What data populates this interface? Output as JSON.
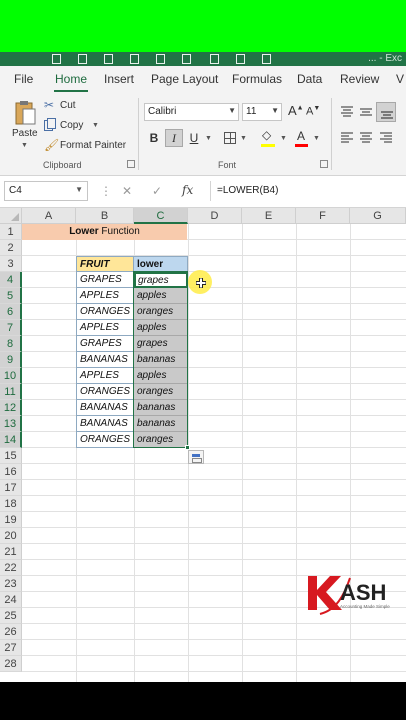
{
  "window": {
    "title_partial": "... -  Exc"
  },
  "ribbon_tabs": [
    "File",
    "Home",
    "Insert",
    "Page Layout",
    "Formulas",
    "Data",
    "Review",
    "V"
  ],
  "active_tab": "Home",
  "clipboard": {
    "paste_label": "Paste",
    "cut_label": "Cut",
    "copy_label": "Copy",
    "format_painter_label": "Format Painter",
    "group_label": "Clipboard"
  },
  "font": {
    "font_name": "Calibri",
    "font_size": "11",
    "bold_label": "B",
    "italic_label": "I",
    "underline_label": "U",
    "group_label": "Font",
    "fill_color": "#ffff00",
    "font_color": "#ff0000"
  },
  "formula_bar": {
    "name_box": "C4",
    "cancel_glyph": "✕",
    "enter_glyph": "✓",
    "fx_label": "fx",
    "formula": "=LOWER(B4)"
  },
  "sheet": {
    "columns": [
      "A",
      "B",
      "C",
      "D",
      "E",
      "F",
      "G"
    ],
    "selected_column": "C",
    "rows": [
      "1",
      "2",
      "3",
      "4",
      "5",
      "6",
      "7",
      "8",
      "9",
      "10",
      "11",
      "12",
      "13",
      "14",
      "15",
      "16",
      "17",
      "18",
      "19",
      "20",
      "21",
      "22",
      "23",
      "24",
      "25",
      "26",
      "27",
      "28"
    ],
    "selected_rows": [
      "4",
      "5",
      "6",
      "7",
      "8",
      "9",
      "10",
      "11",
      "12",
      "13",
      "14"
    ],
    "title_bold": "Lower",
    "title_rest": " Function",
    "header_fruit": "FRUIT",
    "header_lower": "lower",
    "table": [
      {
        "fruit": "GRAPES",
        "lower": "grapes"
      },
      {
        "fruit": "APPLES",
        "lower": "apples"
      },
      {
        "fruit": "ORANGES",
        "lower": "oranges"
      },
      {
        "fruit": "APPLES",
        "lower": "apples"
      },
      {
        "fruit": "GRAPES",
        "lower": "grapes"
      },
      {
        "fruit": "BANANAS",
        "lower": "bananas"
      },
      {
        "fruit": "APPLES",
        "lower": "apples"
      },
      {
        "fruit": "ORANGES",
        "lower": "oranges"
      },
      {
        "fruit": "BANANAS",
        "lower": "bananas"
      },
      {
        "fruit": "BANANAS",
        "lower": "bananas"
      },
      {
        "fruit": "ORANGES",
        "lower": "oranges"
      }
    ]
  },
  "logo": {
    "text": "KASH",
    "tagline": "Accounting Made Simple",
    "accent_color": "#d71920"
  },
  "colors": {
    "banner": "#00ff00",
    "excel_green": "#217346",
    "title_fill": "#f8cbad",
    "fruit_header_fill": "#ffe699",
    "lower_header_fill": "#bdd7ee"
  }
}
